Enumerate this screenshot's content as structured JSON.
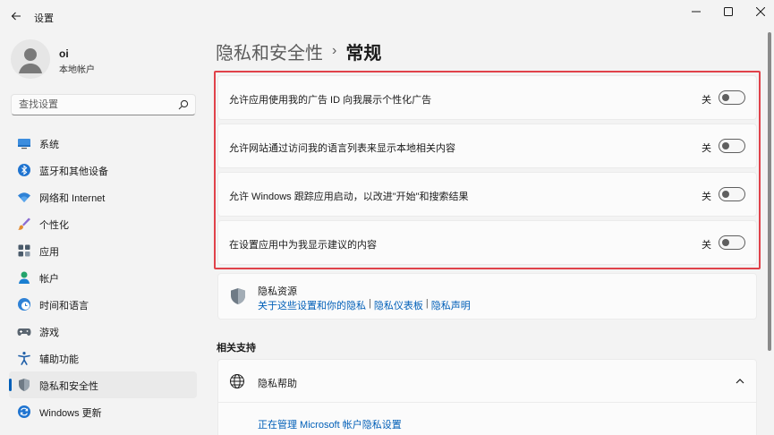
{
  "window": {
    "title": "设置"
  },
  "profile": {
    "name": "oi",
    "account_type": "本地帐户"
  },
  "search": {
    "placeholder": "查找设置"
  },
  "nav": {
    "items": [
      {
        "label": "系统",
        "icon": "monitor-icon"
      },
      {
        "label": "蓝牙和其他设备",
        "icon": "bluetooth-icon"
      },
      {
        "label": "网络和 Internet",
        "icon": "wifi-icon"
      },
      {
        "label": "个性化",
        "icon": "brush-icon"
      },
      {
        "label": "应用",
        "icon": "apps-icon"
      },
      {
        "label": "帐户",
        "icon": "person-icon"
      },
      {
        "label": "时间和语言",
        "icon": "clock-globe-icon"
      },
      {
        "label": "游戏",
        "icon": "gamepad-icon"
      },
      {
        "label": "辅助功能",
        "icon": "accessibility-icon"
      },
      {
        "label": "隐私和安全性",
        "icon": "shield-icon",
        "active": true
      },
      {
        "label": "Windows 更新",
        "icon": "update-icon"
      }
    ]
  },
  "breadcrumb": {
    "parent": "隐私和安全性",
    "separator": "›",
    "current": "常规"
  },
  "settings": [
    {
      "label": "允许应用使用我的广告 ID 向我展示个性化广告",
      "state": "关",
      "on": false
    },
    {
      "label": "允许网站通过访问我的语言列表来显示本地相关内容",
      "state": "关",
      "on": false
    },
    {
      "label": "允许 Windows 跟踪应用启动，以改进\"开始\"和搜索结果",
      "state": "关",
      "on": false
    },
    {
      "label": "在设置应用中为我显示建议的内容",
      "state": "关",
      "on": false
    }
  ],
  "privacy_resources": {
    "title": "隐私资源",
    "links": [
      "关于这些设置和你的隐私",
      "隐私仪表板",
      "隐私声明"
    ],
    "separator": "|"
  },
  "related_support": {
    "title": "相关支持",
    "help_title": "隐私帮助",
    "help_link": "正在管理 Microsoft 帐户隐私设置"
  },
  "colors": {
    "accent": "#005fb8",
    "highlight_border": "#e0424a",
    "background": "#f3f3f3"
  }
}
